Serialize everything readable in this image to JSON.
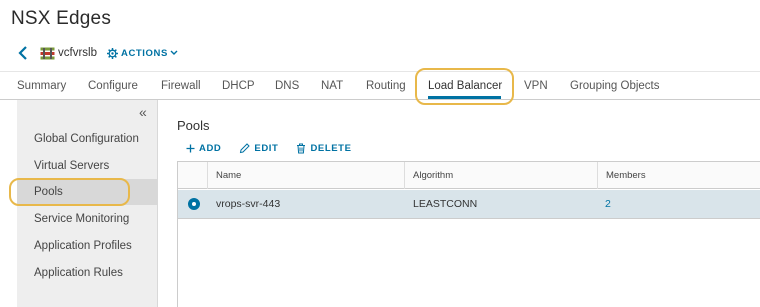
{
  "page": {
    "title": "NSX Edges"
  },
  "breadcrumb": {
    "edge_name": "vcfvrslb",
    "actions_label": "ACTIONS"
  },
  "tabs": [
    {
      "label": "Summary"
    },
    {
      "label": "Configure"
    },
    {
      "label": "Firewall"
    },
    {
      "label": "DHCP"
    },
    {
      "label": "DNS"
    },
    {
      "label": "NAT"
    },
    {
      "label": "Routing"
    },
    {
      "label": "Load Balancer",
      "active": true
    },
    {
      "label": "VPN"
    },
    {
      "label": "Grouping Objects"
    }
  ],
  "sidebar": {
    "collapse_glyph": "«",
    "items": [
      {
        "label": "Global Configuration"
      },
      {
        "label": "Virtual Servers"
      },
      {
        "label": "Pools",
        "selected": true
      },
      {
        "label": "Service Monitoring"
      },
      {
        "label": "Application Profiles"
      },
      {
        "label": "Application Rules"
      }
    ]
  },
  "main": {
    "section_title": "Pools",
    "toolbar": {
      "add_label": "ADD",
      "edit_label": "EDIT",
      "delete_label": "DELETE"
    },
    "columns": [
      "Name",
      "Algorithm",
      "Members"
    ],
    "rows": [
      {
        "name": "vrops-svr-443",
        "algorithm": "LEASTCONN",
        "members": "2",
        "selected": true
      }
    ]
  },
  "colors": {
    "accent": "#0072a3",
    "highlight": "#e8b84a",
    "row_selected": "#d9e4ea"
  },
  "icons": {
    "back": "chevron-left-icon",
    "edge": "nsx-edge-icon",
    "actions": "gear-icon",
    "add": "plus-icon",
    "edit": "pencil-icon",
    "delete": "trash-icon",
    "collapse": "double-chevron-left-icon"
  }
}
